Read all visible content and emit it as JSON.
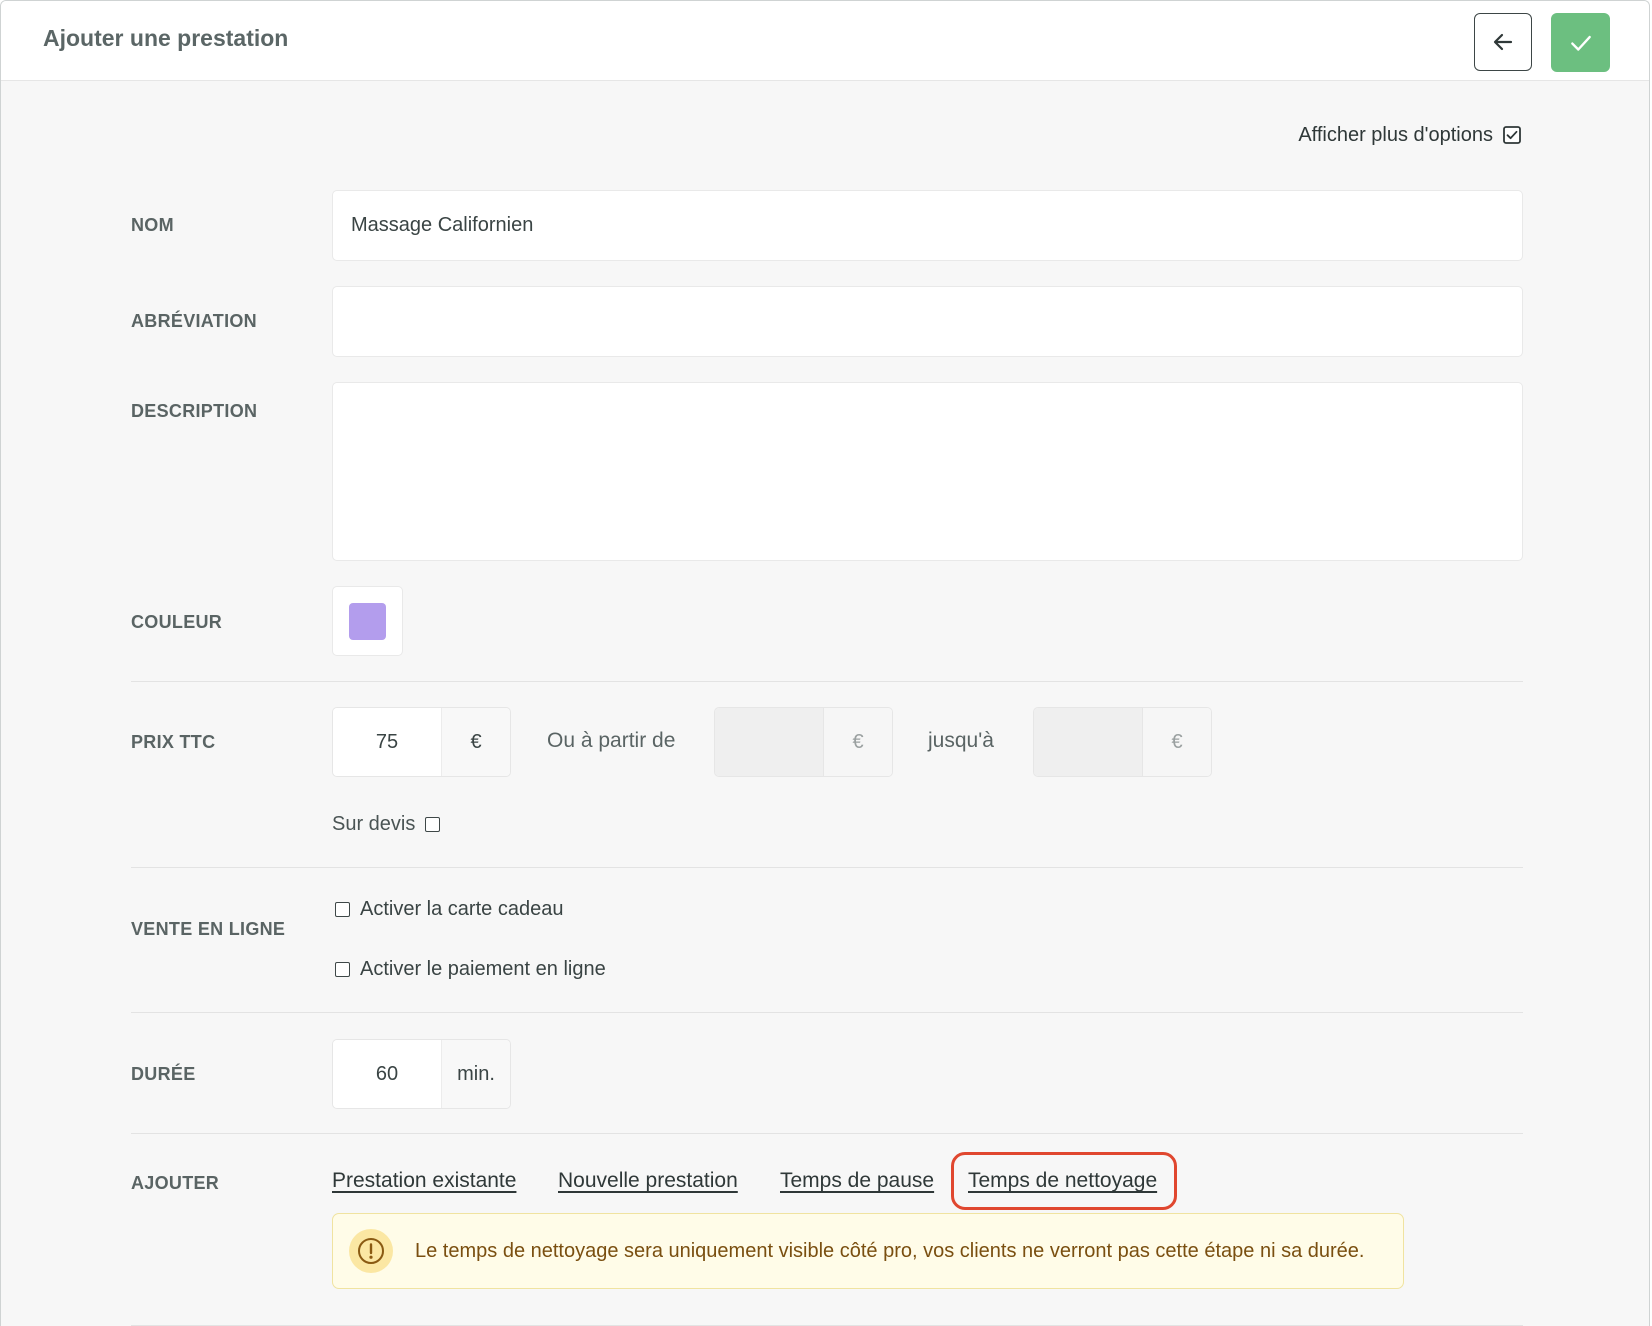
{
  "header": {
    "title": "Ajouter une prestation",
    "back_icon": "arrow-left-icon",
    "save_icon": "check-icon",
    "save_color": "#6cbf80"
  },
  "options": {
    "more_options_label": "Afficher plus d'options",
    "more_options_checked": true
  },
  "form": {
    "name": {
      "label": "NOM",
      "value": "Massage Californien"
    },
    "abbreviation": {
      "label": "ABRÉVIATION",
      "value": ""
    },
    "description": {
      "label": "DESCRIPTION",
      "value": ""
    },
    "color": {
      "label": "COULEUR",
      "value": "#b39ded"
    },
    "price": {
      "label": "PRIX TTC",
      "value": "75",
      "currency": "€",
      "from_label": "Ou à partir de",
      "from_value": "",
      "from_currency": "€",
      "to_label": "jusqu'à",
      "to_value": "",
      "to_currency": "€",
      "quote_label": "Sur devis",
      "quote_checked": false
    },
    "online_sale": {
      "label": "VENTE EN LIGNE",
      "gift_card_label": "Activer la carte cadeau",
      "gift_card_checked": false,
      "online_payment_label": "Activer le paiement en ligne",
      "online_payment_checked": false
    },
    "duration": {
      "label": "DURÉE",
      "value": "60",
      "unit": "min."
    },
    "add": {
      "label": "AJOUTER",
      "links": [
        "Prestation existante",
        "Nouvelle prestation",
        "Temps de pause",
        "Temps de nettoyage"
      ]
    },
    "notice": {
      "icon": "exclamation-circle-icon",
      "text": "Le temps de nettoyage sera uniquement visible côté pro, vos clients ne verront pas cette étape ni sa durée."
    }
  }
}
